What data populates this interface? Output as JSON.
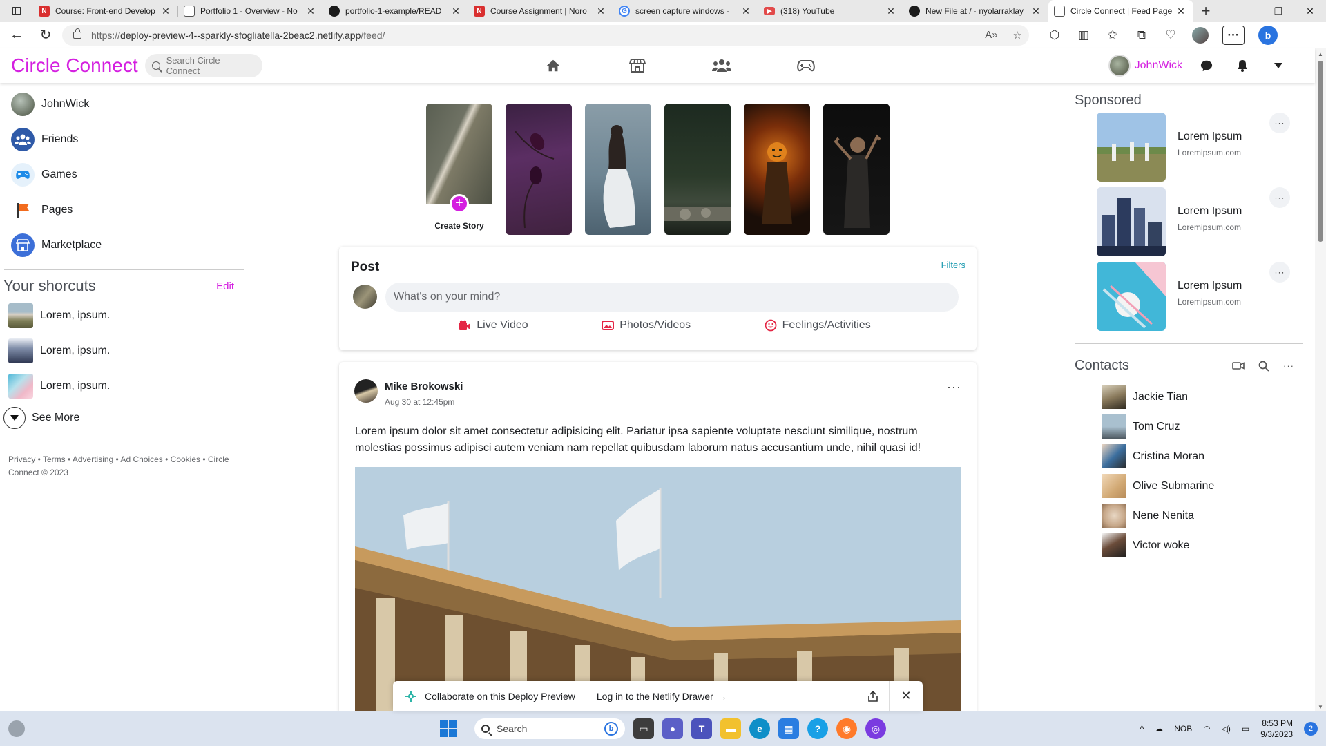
{
  "browser": {
    "tabs": [
      {
        "title": "Course: Front-end Develop",
        "favicon": "noroff-icon",
        "color": "#d92f2f",
        "active": false
      },
      {
        "title": "Portfolio 1 - Overview - No",
        "favicon": "page-icon",
        "color": "#666666",
        "active": false
      },
      {
        "title": "portfolio-1-example/READ",
        "favicon": "github-icon",
        "color": "#1a1a1a",
        "active": false
      },
      {
        "title": "Course Assignment | Noro",
        "favicon": "noroff-icon",
        "color": "#d92f2f",
        "active": false
      },
      {
        "title": "screen capture windows -",
        "favicon": "google-icon",
        "color": "#4285f4",
        "active": false
      },
      {
        "title": "(318) YouTube",
        "favicon": "youtube-icon",
        "color": "#e24a4a",
        "active": false
      },
      {
        "title": "New File at / · nyolarraklay",
        "favicon": "github-icon",
        "color": "#1a1a1a",
        "active": false
      },
      {
        "title": "Circle Connect | Feed Page",
        "favicon": "page-icon",
        "color": "#666666",
        "active": true
      }
    ],
    "url_scheme": "https://",
    "url_host": "deploy-preview-4--sparkly-sfogliatella-2beac2.netlify.app",
    "url_path": "/feed/"
  },
  "app": {
    "brand": "Circle Connect",
    "search_placeholder": "Search Circle Connect",
    "accent_color": "#d41fe0",
    "username": "JohnWick"
  },
  "sidebar": {
    "items": [
      {
        "label": "JohnWick",
        "icon": "avatar"
      },
      {
        "label": "Friends",
        "icon": "friends-icon"
      },
      {
        "label": "Games",
        "icon": "games-icon"
      },
      {
        "label": "Pages",
        "icon": "pages-flag-icon"
      },
      {
        "label": "Marketplace",
        "icon": "marketplace-icon"
      }
    ],
    "shortcuts_title": "Your shorcuts",
    "shortcuts_edit": "Edit",
    "shortcuts": [
      {
        "label": "Lorem, ipsum."
      },
      {
        "label": "Lorem, ipsum."
      },
      {
        "label": "Lorem, ipsum."
      }
    ],
    "see_more": "See More",
    "footer": "Privacy • Terms • Advertising • Ad Choices • Cookies • Circle Connect © 2023"
  },
  "stories": {
    "create_label": "Create Story"
  },
  "composer": {
    "title": "Post",
    "filters": "Filters",
    "placeholder": "What's on your mind?",
    "actions": [
      {
        "label": "Live Video",
        "icon": "video-camera-icon",
        "color": "#e42645"
      },
      {
        "label": "Photos/Videos",
        "icon": "photo-icon",
        "color": "#e42645"
      },
      {
        "label": "Feelings/Activities",
        "icon": "smiley-icon",
        "color": "#e42645"
      }
    ]
  },
  "post": {
    "author": "Mike Brokowski",
    "date": "Aug 30 at 12:45pm",
    "more": "···",
    "body": "Lorem ipsum dolor sit amet consectetur adipisicing elit. Pariatur ipsa sapiente voluptate nesciunt similique, nostrum molestias possimus adipisci autem veniam nam repellat quibusdam laborum natus accusantium unde, nihil quasi id!"
  },
  "netlify": {
    "collaborate": "Collaborate on this Deploy Preview",
    "login": "Log in to the Netlify Drawer"
  },
  "sponsored": {
    "title": "Sponsored",
    "ads": [
      {
        "title": "Lorem Ipsum",
        "url": "Loremipsum.com"
      },
      {
        "title": "Lorem Ipsum",
        "url": "Loremipsum.com"
      },
      {
        "title": "Lorem Ipsum",
        "url": "Loremipsum.com"
      }
    ]
  },
  "contacts": {
    "title": "Contacts",
    "list": [
      {
        "name": "Jackie Tian"
      },
      {
        "name": "Tom Cruz"
      },
      {
        "name": "Cristina Moran"
      },
      {
        "name": "Olive Submarine"
      },
      {
        "name": "Nene Nenita"
      },
      {
        "name": "Victor woke"
      }
    ]
  },
  "taskbar": {
    "search_label": "Search",
    "language": "NOB",
    "time": "8:53 PM",
    "date": "9/3/2023",
    "notifications": "2"
  }
}
